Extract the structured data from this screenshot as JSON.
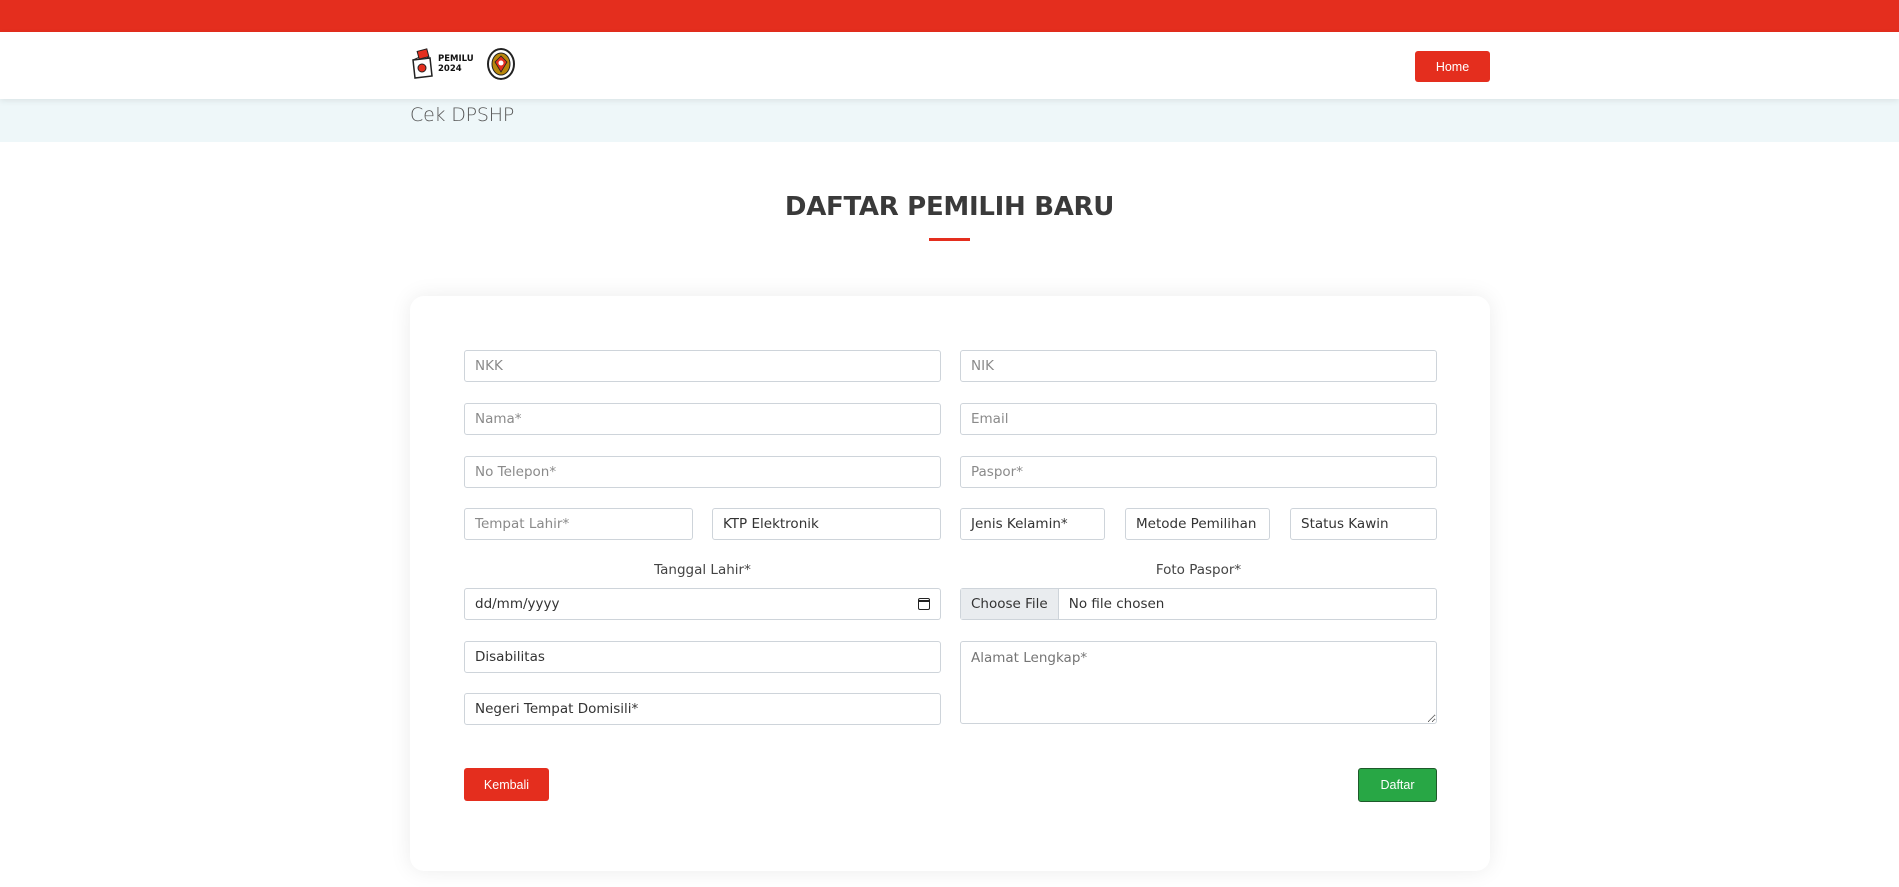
{
  "brand": {
    "logo_text_line1": "PEMILU",
    "logo_text_line2": "2024",
    "accent_color": "#e42e1e",
    "success_color": "#28a745"
  },
  "nav": {
    "home_label": "Home"
  },
  "breadcrumb": {
    "current": "Cek DPSHP"
  },
  "page": {
    "title": "DAFTAR PEMILIH BARU"
  },
  "form": {
    "nkk_placeholder": "NKK",
    "nik_placeholder": "NIK",
    "nama_placeholder": "Nama*",
    "email_placeholder": "Email",
    "telepon_placeholder": "No Telepon*",
    "paspor_placeholder": "Paspor*",
    "tempat_lahir_placeholder": "Tempat Lahir*",
    "ktp_select": "KTP Elektronik",
    "jenis_kelamin_select": "Jenis Kelamin*",
    "metode_pemilihan_select": "Metode Pemilihan",
    "status_kawin_select": "Status Kawin",
    "tanggal_lahir_label": "Tanggal Lahir*",
    "tanggal_lahir_placeholder": "dd/mm/yyyy",
    "foto_paspor_label": "Foto Paspor*",
    "file_button": "Choose File",
    "file_status": "No file chosen",
    "disabilitas_select": "Disabilitas",
    "alamat_placeholder": "Alamat Lengkap*",
    "negeri_select": "Negeri Tempat Domisili*",
    "back_label": "Kembali",
    "submit_label": "Daftar"
  }
}
